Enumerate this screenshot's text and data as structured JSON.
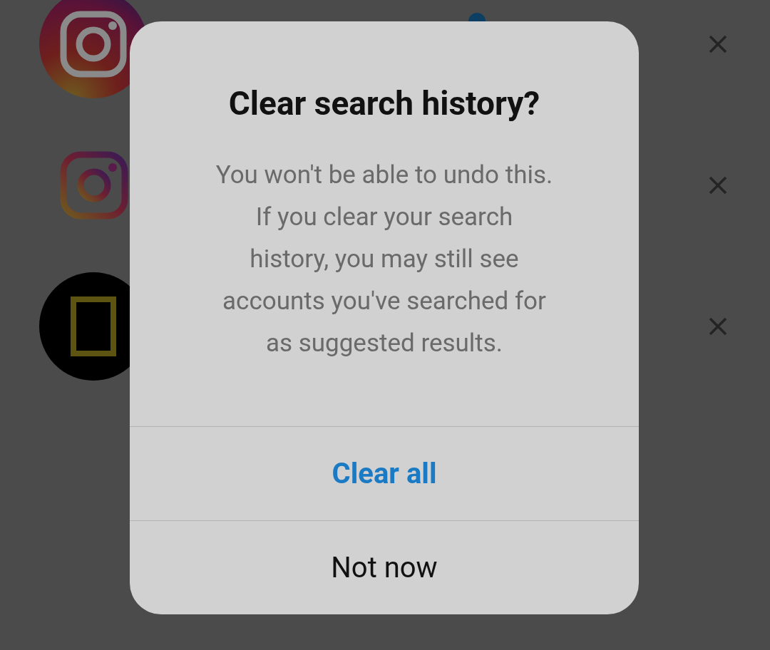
{
  "history": [
    {
      "kind": "instagram-circle",
      "verified": true
    },
    {
      "kind": "instagram-glyph",
      "verified": false
    },
    {
      "kind": "frame-circle",
      "verified": false
    }
  ],
  "dialog": {
    "title": "Clear search history?",
    "message": "You won't be able to undo this. If you clear your search history, you may still see accounts you've searched for as suggested results.",
    "buttons": [
      {
        "label": "Clear all",
        "kind": "primary"
      },
      {
        "label": "Not now",
        "kind": "secondary"
      }
    ]
  }
}
